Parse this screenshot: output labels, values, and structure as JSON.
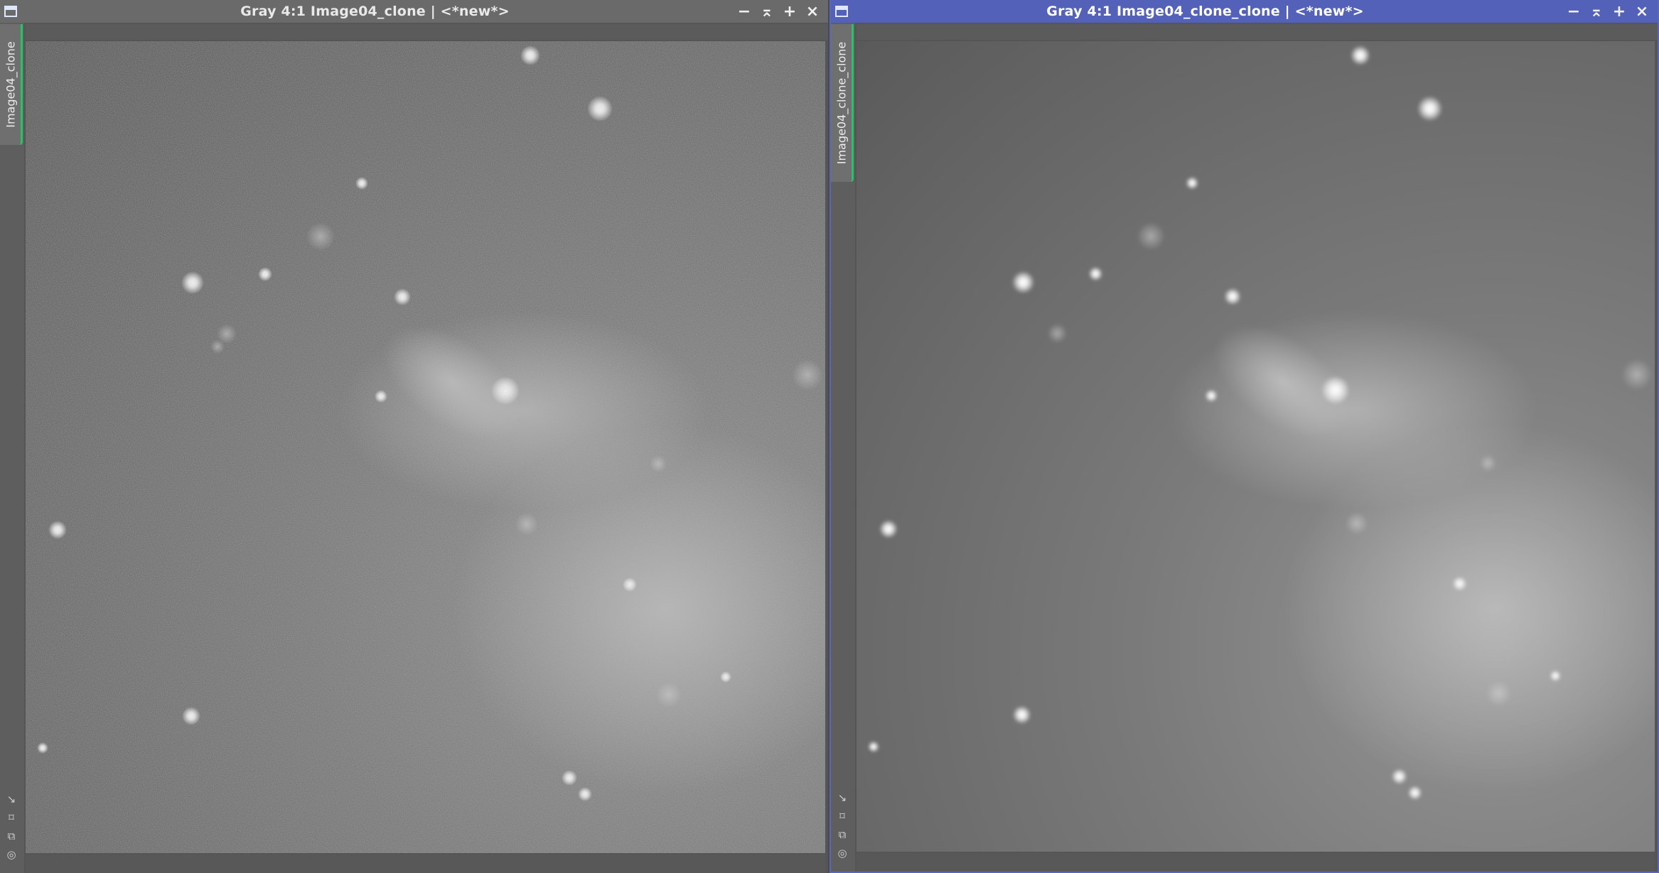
{
  "windows": [
    {
      "id": "left",
      "title": "Gray 4:1 Image04_clone | <*new*>",
      "tab_label": "Image04_clone",
      "active": false
    },
    {
      "id": "right",
      "title": "Gray 4:1 Image04_clone_clone | <*new*>",
      "tab_label": "Image04_clone_clone",
      "active": true
    }
  ],
  "controls": {
    "minimize": "−",
    "shade": "⌅",
    "maximize": "+",
    "close": "×"
  },
  "side_icons": [
    "↘",
    "⌑",
    "⧉",
    "◎"
  ],
  "icons": {
    "window": "window-icon",
    "minimize": "minimize-icon",
    "shade": "shade-icon",
    "maximize": "maximize-icon",
    "close": "close-icon"
  },
  "colors": {
    "active_title": "#5361b8",
    "inactive_title": "#6a6a6a",
    "tab_accent": "#27c26b"
  }
}
